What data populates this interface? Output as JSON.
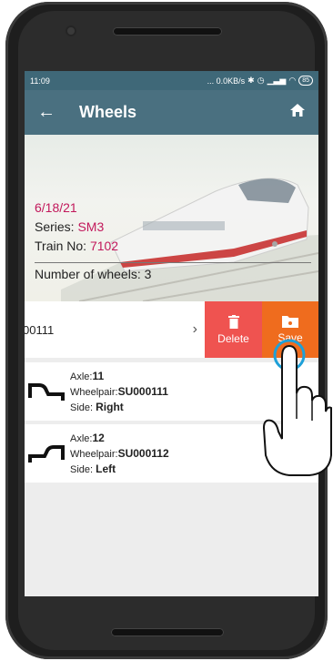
{
  "status_bar": {
    "time": "11:09",
    "network": "... 0.0KB/s",
    "battery": "85"
  },
  "app_bar": {
    "title": "Wheels"
  },
  "train": {
    "date": "6/18/21",
    "series_label": "Series: ",
    "series_value": "SM3",
    "train_no_label": "Train No: ",
    "train_no_value": "7102",
    "wheels_label": "Number of wheels: ",
    "wheels_value": "3"
  },
  "swiped_row": {
    "code": "00111",
    "delete_label": "Delete",
    "save_label": "Save"
  },
  "wheels": [
    {
      "axle_label": "Axle:",
      "axle": "11",
      "wheelpair_label": "Wheelpair:",
      "wheelpair": "SU000111",
      "side_label": "Side: ",
      "side": "Right"
    },
    {
      "axle_label": "Axle:",
      "axle": "12",
      "wheelpair_label": "Wheelpair:",
      "wheelpair": "SU000112",
      "side_label": "Side: ",
      "side": "Left"
    }
  ],
  "colors": {
    "appbar": "#4a7080",
    "accent": "#c2185b",
    "delete": "#ef5350",
    "save": "#ef6c1e"
  }
}
